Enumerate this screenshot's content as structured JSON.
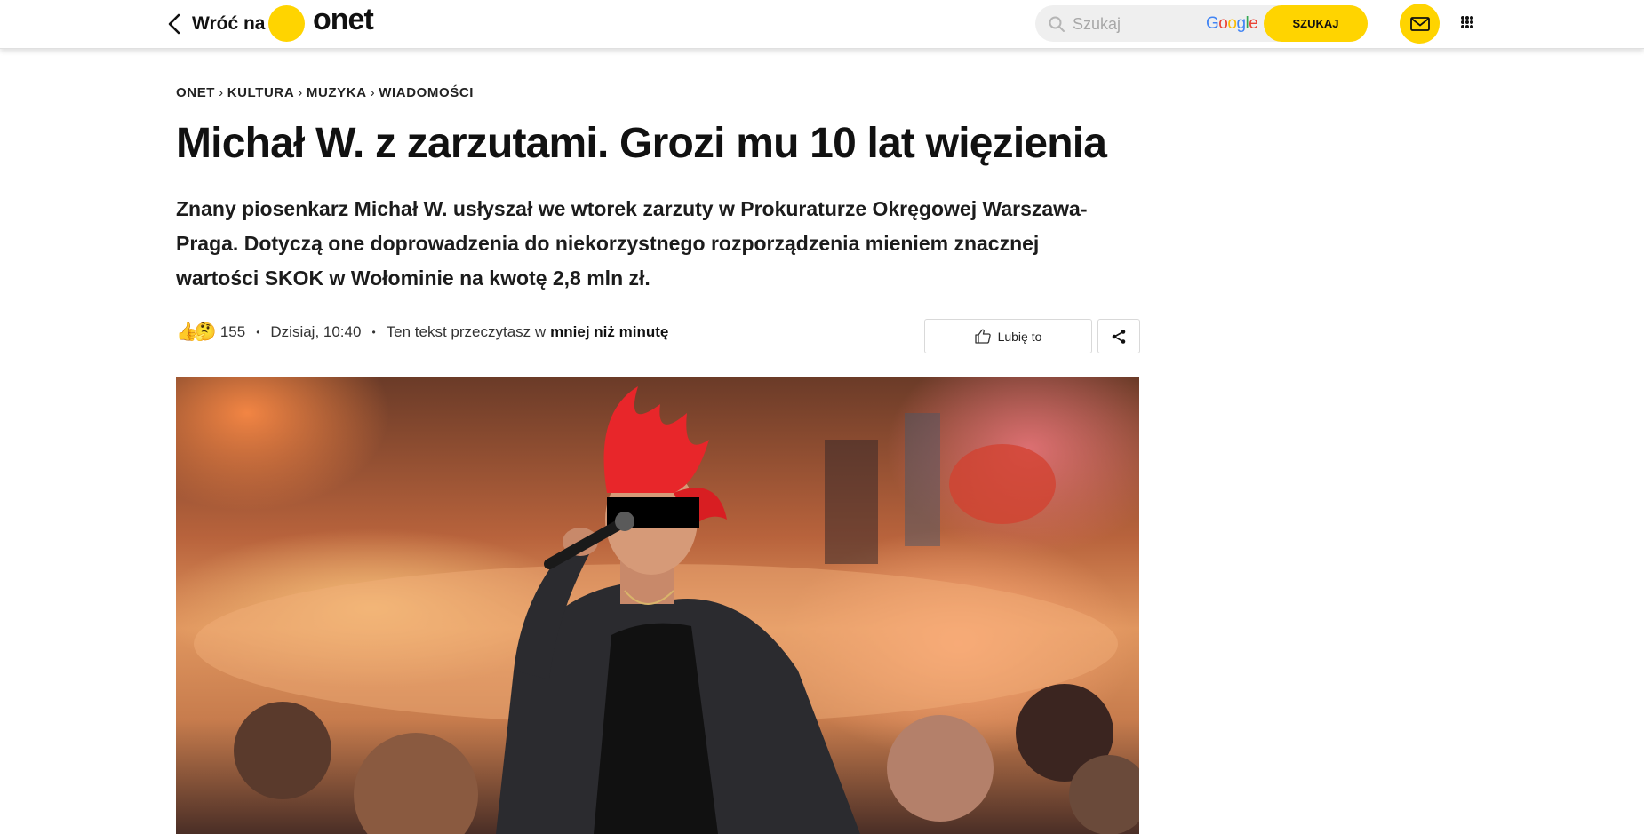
{
  "header": {
    "back_label": "Wróć na",
    "logo_text": "onet",
    "search_placeholder": "Szukaj",
    "google_label": "Google",
    "search_button": "SZUKAJ"
  },
  "breadcrumb": [
    "ONET",
    "KULTURA",
    "MUZYKA",
    "WIADOMOŚCI"
  ],
  "article": {
    "title": "Michał W. z zarzutami. Grozi mu 10 lat więzienia",
    "lead": "Znany piosenkarz Michał W. usłyszał we wtorek zarzuty w Prokuraturze Okręgowej Warszawa-Praga. Dotyczą one doprowadzenia do niekorzystnego rozporządzenia mieniem znacznej wartości SKOK w Wołominie na kwotę 2,8 mln zł.",
    "reactions_count": "155",
    "published": "Dzisiaj, 10:40",
    "read_time_prefix": "Ten tekst przeczytasz w",
    "read_time_value": "mniej niż minutę",
    "like_label": "Lubię to"
  },
  "colors": {
    "accent": "#ffd400",
    "text": "#111111"
  },
  "icons": {
    "back": "chevron-left-icon",
    "search": "magnifier-icon",
    "mail": "envelope-icon",
    "apps": "apps-grid-icon",
    "like": "thumbs-up-icon",
    "share": "share-icon"
  }
}
